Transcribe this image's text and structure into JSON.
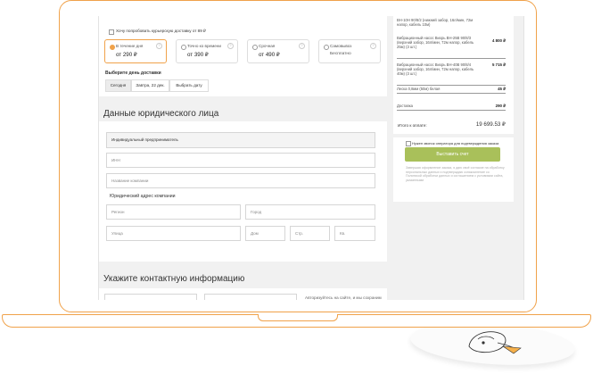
{
  "delivery": {
    "courier_checkbox_label": "Хочу попробовать курьерскую доставку от 89 ₽",
    "options": [
      {
        "name": "В течение дня",
        "price": "от 290 ₽",
        "selected": true
      },
      {
        "name": "Точно ко времени",
        "price": "от 390 ₽",
        "selected": false
      },
      {
        "name": "Срочная",
        "price": "от 490 ₽",
        "selected": false
      },
      {
        "name": "Самовывоз",
        "price": "Бесплатно",
        "selected": false
      }
    ],
    "info_mark": "?",
    "day_label": "Выберите день доставки",
    "day_buttons": [
      "Сегодня",
      "Завтра, 22 дек.",
      "Выбрать дату"
    ]
  },
  "legal": {
    "title": "Данные юридического лица",
    "entity_type": "Индивидуальный предприниматель",
    "inn_placeholder": "ИНН",
    "company_name_placeholder": "Название компании",
    "address_label": "Юридический адрес компании",
    "region_placeholder": "Регион",
    "city_placeholder": "Город",
    "street_placeholder": "Улица",
    "house_placeholder": "Дом",
    "building_placeholder": "Стр.",
    "apartment_placeholder": "Кв."
  },
  "contact": {
    "title": "Укажите контактную информацию",
    "note": "Авторизуйтесь на сайте, и мы сохраним"
  },
  "order_summary": {
    "items": [
      {
        "name": "ВН-10Н 90/8/2 (нижний забор, 16л/мин, 72м напор, кабель 10м)",
        "price": ""
      },
      {
        "name": "Вибрационный насос Вихрь ВН-25В 90/8/3 (верхний забор, 16л/мин, 72м напор, кабель 25м) (3 шт.)",
        "price": "4 800 ₽"
      },
      {
        "name": "Вибрационный насос Вихрь ВН-40В 90/8/4 (верхний забор, 16л/мин, 72м напор, кабель 40м) (3 шт.)",
        "price": "5 715 ₽"
      },
      {
        "name": "Леска 0,8мм (50м) белая",
        "price": "45 ₽"
      },
      {
        "name": "Доставка",
        "price": "290 ₽"
      }
    ],
    "total_label": "Итого к оплате:",
    "total_value": "19 699.53 ₽",
    "operator_checkbox_label": "Нужен звонок оператора для подтверждения заказа",
    "invoice_button": "Выставить счет",
    "consent_text": "Завершая оформление заказа, я даю своё согласие на обработку персональных данных и подтверждаю ознакомление со Политикой обработки данных и соглашением с условиями сайта, указанными"
  },
  "colors": {
    "accent": "#f0a24a",
    "invoice_button": "#a9c05a",
    "page_background": "#f1f1f1"
  }
}
